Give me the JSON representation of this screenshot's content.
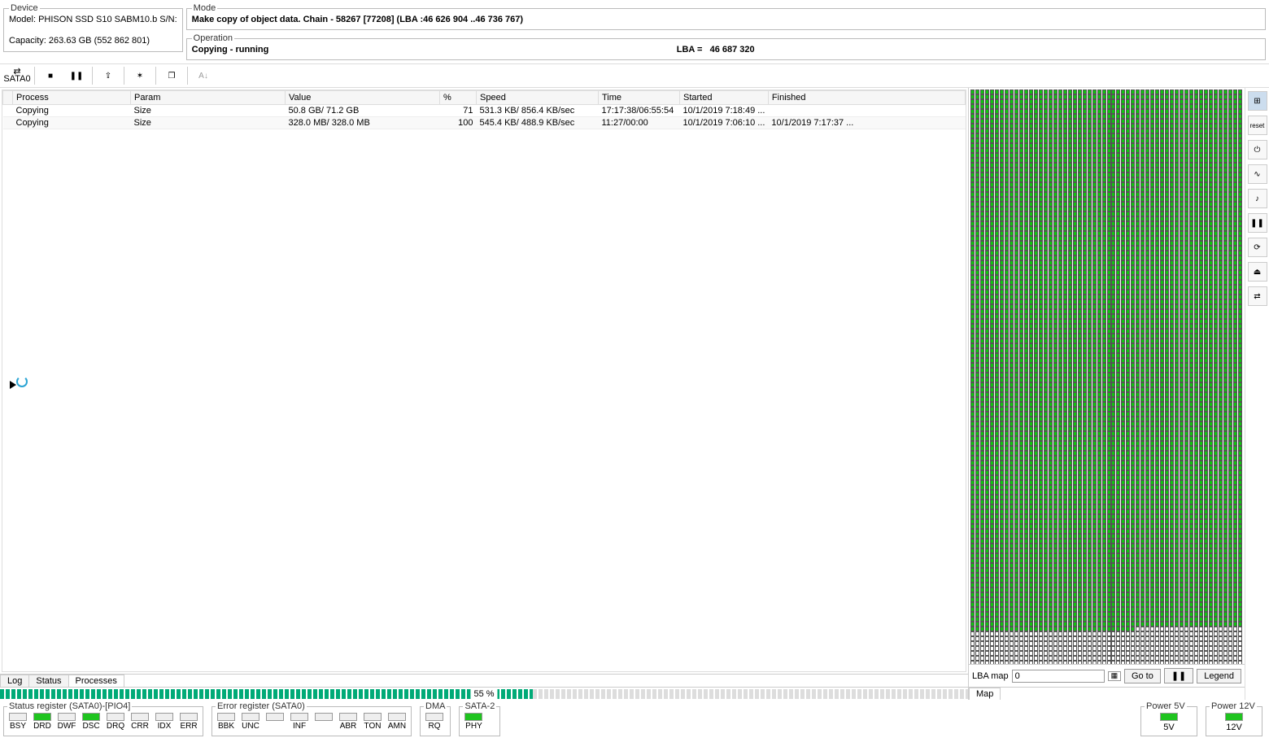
{
  "device": {
    "legend": "Device",
    "model_label": "Model:",
    "model": "PHISON SSD S10 SABM10.b S/N:",
    "capacity_label": "Capacity:",
    "capacity": "263.63 GB (552 862 801)"
  },
  "mode": {
    "legend": "Mode",
    "text": "Make copy of object data. Chain - 58267 [77208] (LBA :46 626 904 ..46 736 767)"
  },
  "operation": {
    "legend": "Operation",
    "status": "Copying - running",
    "lba_label": "LBA  =",
    "lba_value": "46 687 320"
  },
  "toolbar": {
    "port": "SATA0",
    "stop": "■",
    "pause": "❚❚",
    "export": "⇪",
    "settings": "✶",
    "copy": "❐",
    "sort": "A↓"
  },
  "table": {
    "headers": {
      "process": "Process",
      "param": "Param",
      "value": "Value",
      "pct": "%",
      "speed": "Speed",
      "time": "Time",
      "started": "Started",
      "finished": "Finished"
    },
    "rows": [
      {
        "process": "Copying",
        "param": "Size",
        "value": "50.8 GB/ 71.2 GB",
        "pct": "71",
        "speed": "531.3 KB/ 856.4 KB/sec",
        "time": "17:17:38/06:55:54",
        "started": "10/1/2019 7:18:49 ...",
        "finished": ""
      },
      {
        "process": "Copying",
        "param": "Size",
        "value": "328.0 MB/ 328.0 MB",
        "pct": "100",
        "speed": "545.4 KB/ 488.9 KB/sec",
        "time": "11:27/00:00",
        "started": "10/1/2019 7:06:10 ...",
        "finished": "10/1/2019 7:17:37 ..."
      }
    ]
  },
  "tabs": {
    "log": "Log",
    "status": "Status",
    "processes": "Processes"
  },
  "progress": {
    "pct_text": "55 %",
    "pct_value": 55
  },
  "status_reg": {
    "legend": "Status register (SATA0)-[PIO4]",
    "cells": [
      {
        "label": "BSY",
        "on": false
      },
      {
        "label": "DRD",
        "on": true
      },
      {
        "label": "DWF",
        "on": false
      },
      {
        "label": "DSC",
        "on": true
      },
      {
        "label": "DRQ",
        "on": false
      },
      {
        "label": "CRR",
        "on": false
      },
      {
        "label": "IDX",
        "on": false
      },
      {
        "label": "ERR",
        "on": false
      }
    ]
  },
  "error_reg": {
    "legend": "Error register (SATA0)",
    "cells": [
      {
        "label": "BBK",
        "on": false
      },
      {
        "label": "UNC",
        "on": false
      },
      {
        "label": "",
        "on": false
      },
      {
        "label": "INF",
        "on": false
      },
      {
        "label": "",
        "on": false
      },
      {
        "label": "ABR",
        "on": false
      },
      {
        "label": "TON",
        "on": false
      },
      {
        "label": "AMN",
        "on": false
      }
    ]
  },
  "dma": {
    "legend": "DMA",
    "cells": [
      {
        "label": "RQ",
        "on": false
      }
    ]
  },
  "sata2": {
    "legend": "SATA-2",
    "cells": [
      {
        "label": "PHY",
        "on": true
      }
    ]
  },
  "map": {
    "lba_map_label": "LBA map",
    "input_value": "0",
    "goto": "Go to",
    "pause": "❚❚",
    "legend_btn": "Legend",
    "tab_map": "Map",
    "grid": {
      "cols": 56,
      "rows": 124,
      "green_rows": 110,
      "last_green_row_cols": 34
    }
  },
  "right_tools": {
    "drive": "⊞",
    "reset": "reset",
    "power": "⏻",
    "osc": "∿",
    "note": "♪",
    "pause2": "❚❚",
    "refresh": "⟳",
    "eject": "⏏",
    "conn": "⇄"
  },
  "power": {
    "p5": {
      "legend": "Power 5V",
      "label": "5V"
    },
    "p12": {
      "legend": "Power 12V",
      "label": "12V"
    }
  }
}
